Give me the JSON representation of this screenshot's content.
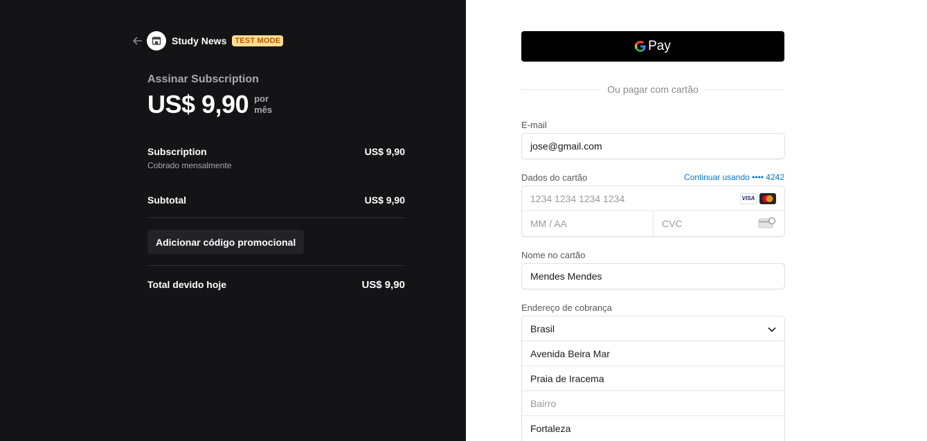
{
  "header": {
    "brand": "Study News",
    "badge": "TEST MODE"
  },
  "summary": {
    "title": "Assinar Subscription",
    "price": "US$ 9,90",
    "period_line1": "por",
    "period_line2": "mês"
  },
  "line_items": [
    {
      "name": "Subscription",
      "desc": "Cobrado mensalmente",
      "amount": "US$ 9,90"
    }
  ],
  "subtotal": {
    "label": "Subtotal",
    "amount": "US$ 9,90"
  },
  "promo_button": "Adicionar código promocional",
  "total": {
    "label": "Total devido hoje",
    "amount": "US$ 9,90"
  },
  "payment": {
    "gpay_label": "Pay",
    "divider_text": "Ou pagar com cartão",
    "email": {
      "label": "E-mail",
      "value": "jose@gmail.com"
    },
    "card": {
      "label": "Dados do cartão",
      "continue_link": "Continuar usando •••• 4242",
      "number_placeholder": "1234 1234 1234 1234",
      "expiry_placeholder": "MM / AA",
      "cvc_placeholder": "CVC",
      "visa_text": "VISA"
    },
    "name": {
      "label": "Nome no cartão",
      "value": "Mendes Mendes"
    },
    "billing": {
      "label": "Endereço de cobrança",
      "country": "Brasil",
      "line1": "Avenida Beira Mar",
      "line2": "Praia de Iracema",
      "neighborhood_placeholder": "Bairro",
      "city": "Fortaleza"
    }
  },
  "colors": {
    "left_bg": "#141416",
    "badge_bg": "#ffde92",
    "badge_text": "#bb5504",
    "link": "#0570de"
  }
}
